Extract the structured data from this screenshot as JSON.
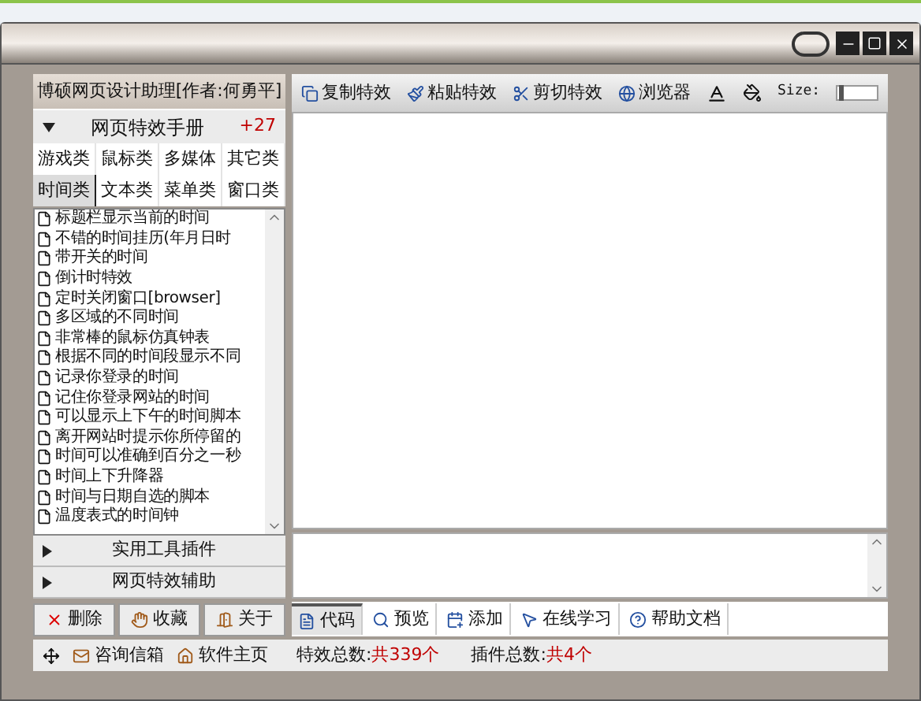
{
  "app_title": "博硕网页设计助理[作者:何勇平]",
  "manual_section": {
    "label": "网页特效手册",
    "count": "+27",
    "expanded": true
  },
  "category_tabs": [
    {
      "label": "游戏类",
      "selected": false
    },
    {
      "label": "鼠标类",
      "selected": false
    },
    {
      "label": "多媒体",
      "selected": false
    },
    {
      "label": "其它类",
      "selected": false
    },
    {
      "label": "时间类",
      "selected": true
    },
    {
      "label": "文本类",
      "selected": false
    },
    {
      "label": "菜单类",
      "selected": false
    },
    {
      "label": "窗口类",
      "selected": false
    }
  ],
  "effects": [
    "标题栏显示当前的时间",
    "不错的时间挂历(年月日时",
    "带开关的时间",
    "倒计时特效",
    "定时关闭窗口[browser]",
    "多区域的不同时间",
    "非常棒的鼠标仿真钟表",
    "根据不同的时间段显示不同",
    "记录你登录的时间",
    "记住你登录网站的时间",
    "可以显示上下午的时间脚本",
    "离开网站时提示你所停留的",
    "时间可以准确到百分之一秒",
    "时间上下升降器",
    "时间与日期自选的脚本",
    "温度表式的时间钟"
  ],
  "sections": [
    {
      "label": "实用工具插件",
      "expanded": false
    },
    {
      "label": "网页特效辅助",
      "expanded": false
    }
  ],
  "action_buttons": [
    {
      "label": "删除",
      "kind": "delete"
    },
    {
      "label": "收藏",
      "kind": "favorite"
    },
    {
      "label": "关于",
      "kind": "about"
    }
  ],
  "toolbar": [
    {
      "label": "复制特效",
      "kind": "copy"
    },
    {
      "label": "粘贴特效",
      "kind": "paste"
    },
    {
      "label": "剪切特效",
      "kind": "cut"
    },
    {
      "label": "浏览器",
      "kind": "browser"
    }
  ],
  "size": {
    "label": "Size:",
    "level": 0.02
  },
  "editor_tabs": [
    {
      "label": "代码",
      "kind": "code",
      "selected": true
    },
    {
      "label": "预览",
      "kind": "preview",
      "selected": false
    },
    {
      "label": "添加",
      "kind": "add",
      "selected": false
    },
    {
      "label": "在线学习",
      "kind": "learn",
      "selected": false
    },
    {
      "label": "帮助文档",
      "kind": "help",
      "selected": false
    }
  ],
  "status_bar": {
    "links": [
      {
        "label": "咨询信箱",
        "kind": "mail"
      },
      {
        "label": "软件主页",
        "kind": "home"
      }
    ],
    "effects_total": {
      "label": "特效总数:",
      "value": "共339个"
    },
    "plugins_total": {
      "label": "插件总数:",
      "value": "共4个"
    }
  }
}
